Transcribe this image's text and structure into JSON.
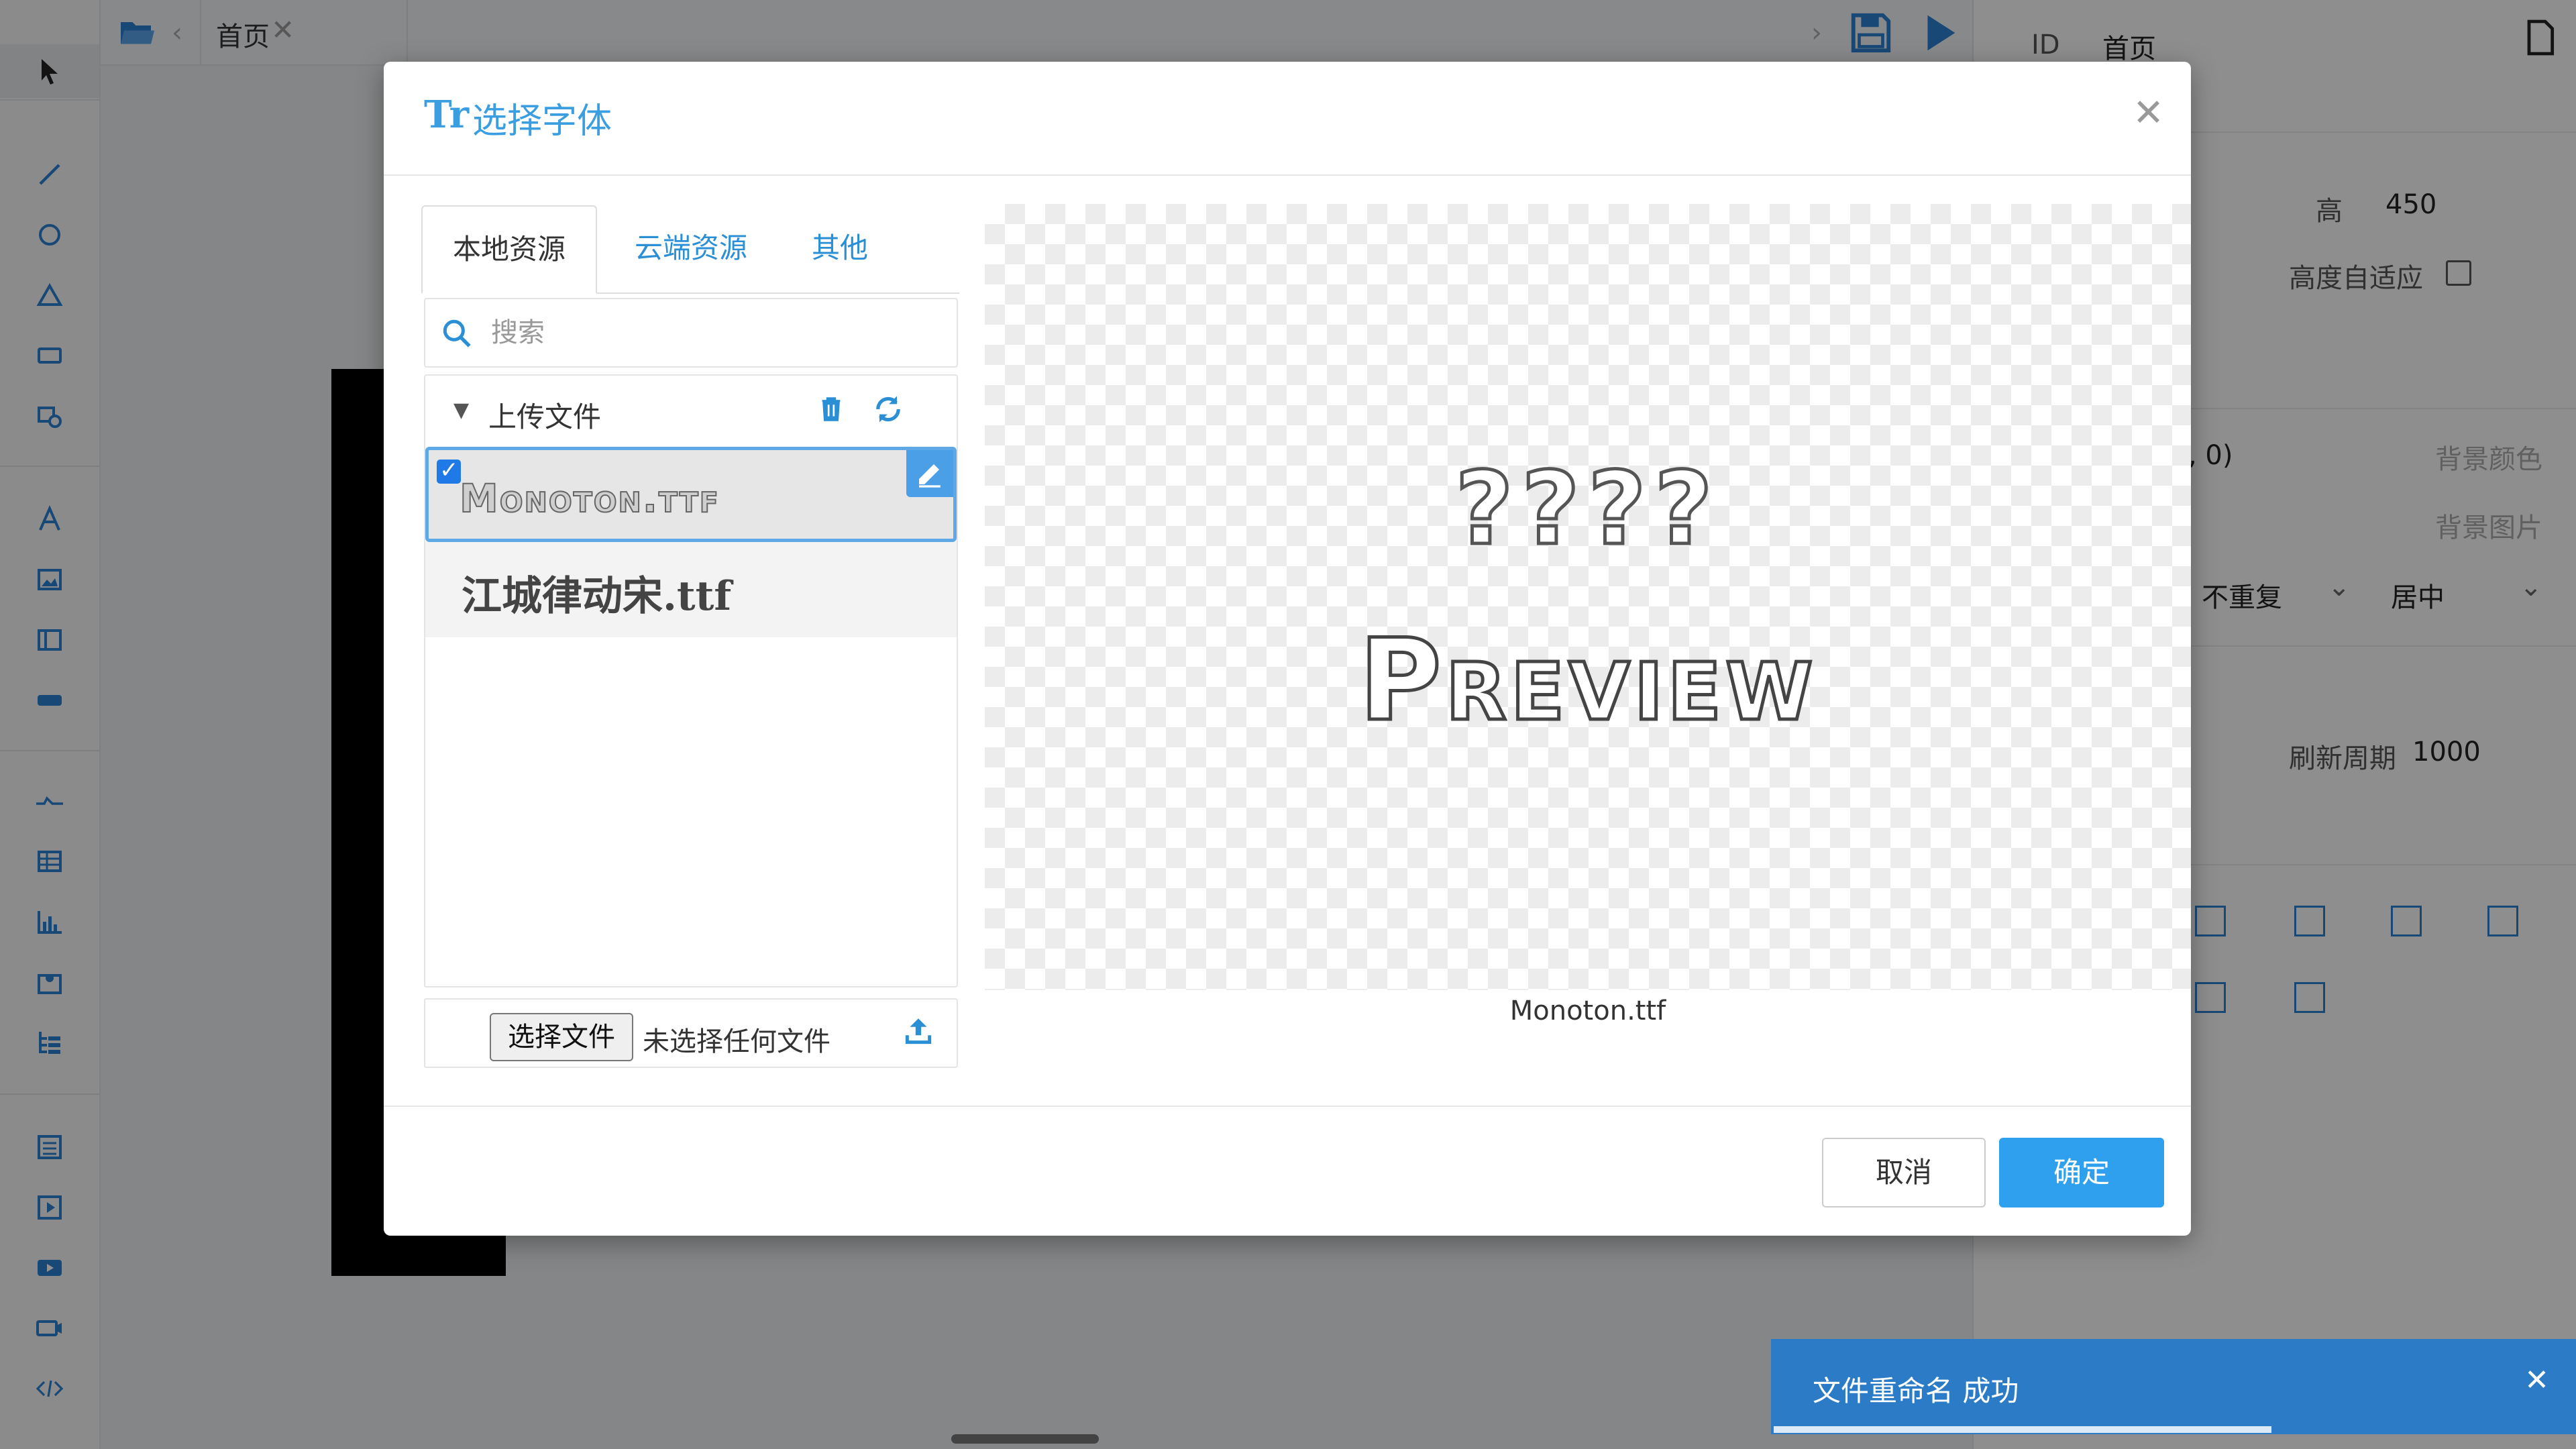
{
  "app": {
    "tab_label": "首页",
    "right_panel": {
      "id_label": "ID",
      "id_value": "首页",
      "height_label": "高",
      "height_value": "450",
      "auto_height_label": "高度自适应",
      "coord_text": ", 0)",
      "bg_color_label": "背景颜色",
      "bg_image_label": "背景图片",
      "repeat_value": "不重复",
      "position_value": "居中",
      "refresh_label": "刷新周期",
      "refresh_value": "1000"
    }
  },
  "dialog": {
    "title": "选择字体",
    "title_icon": "Tr",
    "tabs": [
      {
        "label": "本地资源",
        "active": true
      },
      {
        "label": "云端资源",
        "active": false
      },
      {
        "label": "其他",
        "active": false
      }
    ],
    "search_placeholder": "搜索",
    "group_label": "上传文件",
    "files": [
      {
        "name": "Monoton.ttf",
        "selected": true
      },
      {
        "name": "江城律动宋.ttf",
        "selected": false
      }
    ],
    "choose_file_label": "选择文件",
    "no_file_label": "未选择任何文件",
    "preview_glyphs": "????",
    "preview_word": "Preview",
    "preview_caption": "Monoton.ttf",
    "cancel_label": "取消",
    "ok_label": "确定"
  },
  "toast": {
    "message": "文件重命名 成功",
    "progress": 0.62
  },
  "colors": {
    "accent": "#3a9ee0",
    "primary_button": "#2fa0ee",
    "toast_bg": "#2c7bc7"
  },
  "icons": [
    "pointer-icon",
    "line-icon",
    "circle-icon",
    "triangle-icon",
    "rectangle-icon",
    "shape-edit-icon",
    "text-icon",
    "image-icon",
    "frame-icon",
    "button-icon",
    "connector-icon",
    "table-icon",
    "bar-chart-icon",
    "map-icon",
    "tree-icon",
    "list-icon",
    "media-icon",
    "video-icon",
    "camera-icon",
    "code-icon",
    "layers-icon",
    "folder-icon",
    "save-icon",
    "play-icon",
    "page-icon",
    "trash-icon",
    "refresh-icon",
    "edit-icon",
    "upload-icon",
    "close-icon"
  ]
}
